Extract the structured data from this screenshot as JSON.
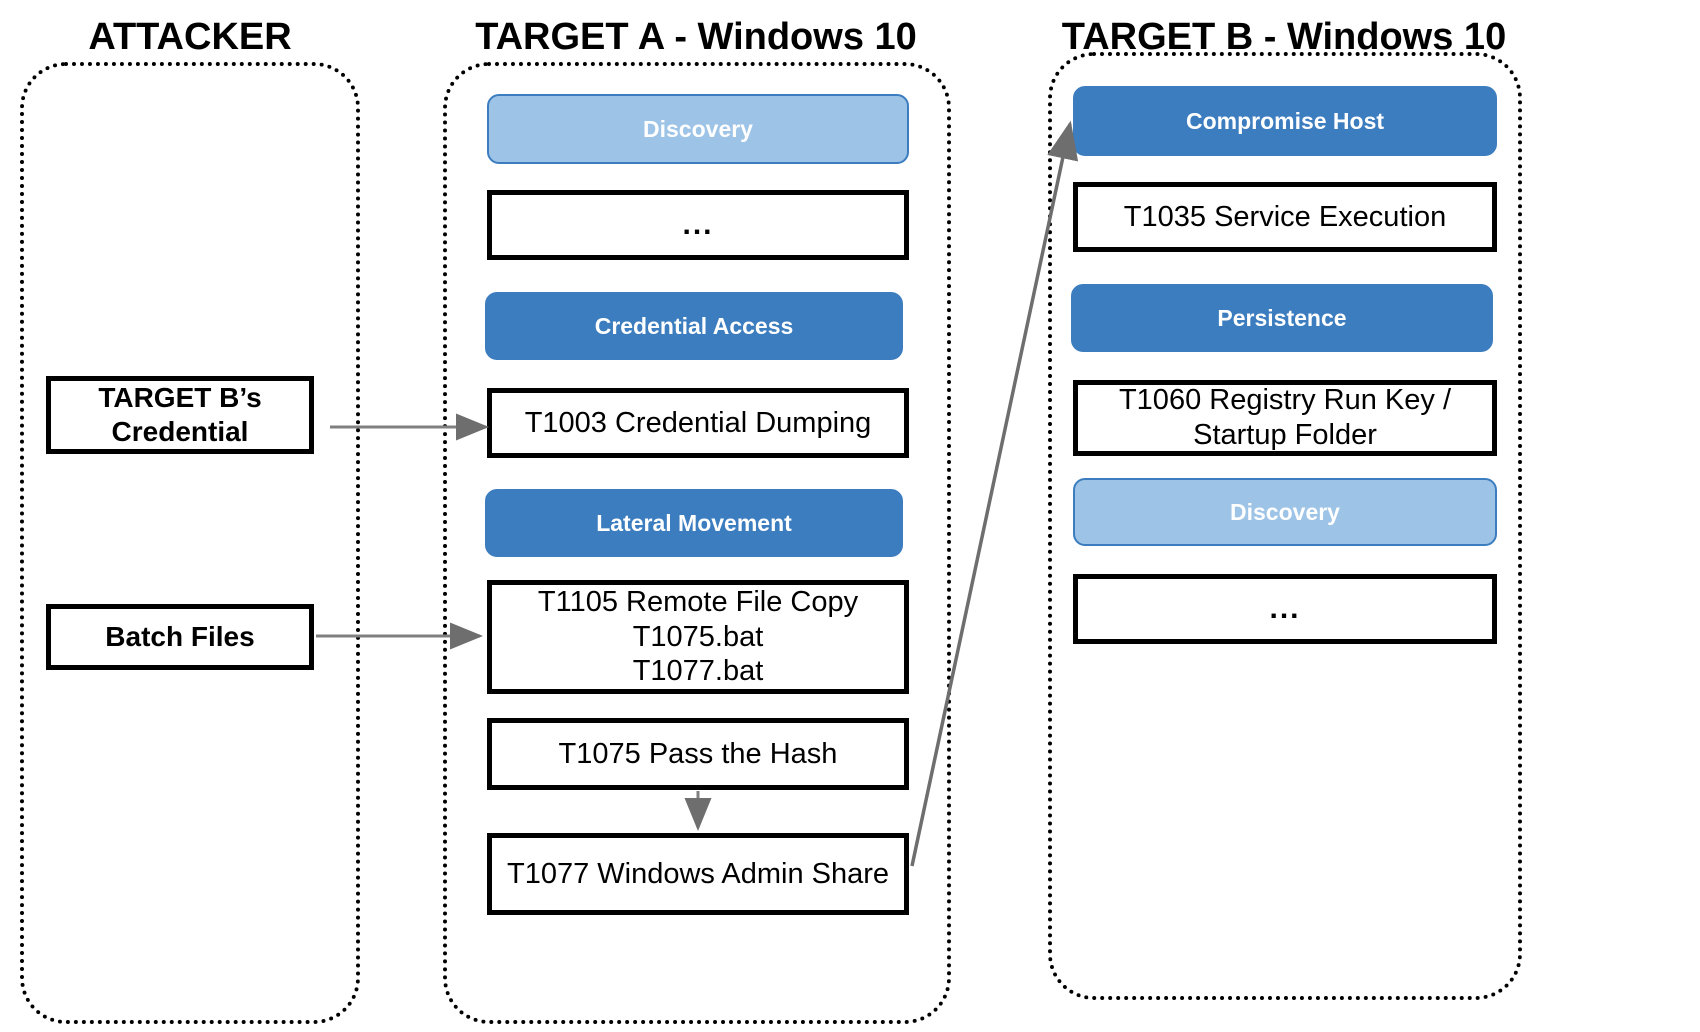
{
  "columns": {
    "attacker": {
      "title": "ATTACKER"
    },
    "target_a": {
      "title": "TARGET A - Windows 10"
    },
    "target_b": {
      "title": "TARGET B - Windows 10"
    }
  },
  "attacker_boxes": [
    {
      "label": "TARGET B’s\nCredential"
    },
    {
      "label": "Batch Files"
    }
  ],
  "target_a_boxes": [
    {
      "kind": "tactic-light",
      "label": "Discovery"
    },
    {
      "kind": "technique",
      "label": "..."
    },
    {
      "kind": "tactic-dark",
      "label": "Credential Access"
    },
    {
      "kind": "technique",
      "label": "T1003 Credential Dumping"
    },
    {
      "kind": "tactic-dark",
      "label": "Lateral Movement"
    },
    {
      "kind": "technique",
      "label": "T1105 Remote File Copy\nT1075.bat\nT1077.bat"
    },
    {
      "kind": "technique",
      "label": "T1075 Pass the Hash"
    },
    {
      "kind": "technique",
      "label": "T1077 Windows Admin Share"
    }
  ],
  "target_b_boxes": [
    {
      "kind": "tactic-dark",
      "label": "Compromise Host"
    },
    {
      "kind": "technique",
      "label": "T1035 Service Execution"
    },
    {
      "kind": "tactic-dark",
      "label": "Persistence"
    },
    {
      "kind": "technique",
      "label": "T1060 Registry Run Key /\nStartup Folder"
    },
    {
      "kind": "tactic-light",
      "label": "Discovery"
    },
    {
      "kind": "technique",
      "label": "..."
    }
  ],
  "colors": {
    "tactic_dark": "#3C7DBF",
    "tactic_light": "#9DC3E6",
    "box_border": "#000000",
    "arrow": "#7F7F7F",
    "text": "#000000",
    "tactic_text": "#FFFFFF",
    "background": "#FFFFFF"
  },
  "arrows": [
    {
      "name": "credential-dumping-to-target-b-credential",
      "direction": "left"
    },
    {
      "name": "batch-files-to-remote-file-copy",
      "direction": "right"
    },
    {
      "name": "pass-the-hash-to-windows-admin-share",
      "direction": "down"
    },
    {
      "name": "windows-admin-share-to-compromise-host",
      "direction": "diagonal-up-right-to-left"
    }
  ]
}
